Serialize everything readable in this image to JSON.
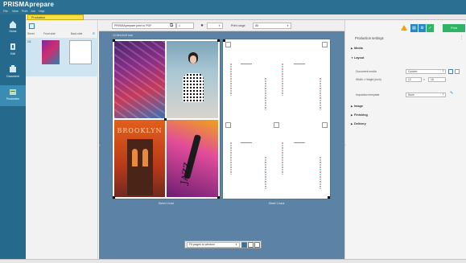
{
  "app": {
    "title": "PRISMAprepare"
  },
  "menu": [
    "File",
    "View",
    "Print",
    "Job",
    "Help"
  ],
  "ribbon": [
    {
      "key": "home",
      "label": "Home",
      "icon": "home-icon"
    },
    {
      "key": "edit",
      "label": "Edit",
      "icon": "edit-icon"
    },
    {
      "key": "document",
      "label": "Document",
      "icon": "document-icon"
    },
    {
      "key": "production",
      "label": "Production",
      "icon": "production-icon"
    }
  ],
  "doc_tab": {
    "label": "Production"
  },
  "thumbnails": {
    "headers": {
      "sheet": "Sheet",
      "front": "Front side",
      "back": "Back side"
    },
    "rows": [
      {
        "num": "1/1"
      }
    ]
  },
  "toolbar": {
    "printer": "PRISMAprepare print to PDF",
    "copies": "1",
    "print_range_label": "Print range",
    "print_range": "All"
  },
  "canvas": {
    "sheet_size": "12.00x18.00 inch",
    "front_caption": "Sheet 1 front",
    "back_caption": "Sheet 1 back",
    "brooklyn": "BROOKLYN",
    "jazz": "JAZZ"
  },
  "zoom": {
    "value": "Fit pages to window"
  },
  "panel": {
    "print_label": "Print",
    "title": "Production settings",
    "sections": {
      "media": "Media",
      "layout": "Layout",
      "image": "Image",
      "finishing": "Finishing",
      "delivery": "Delivery"
    },
    "document_media_label": "Document media",
    "document_media_value": "Custom",
    "size_label": "Width × Height (inch)",
    "width": "12",
    "height": "18",
    "times": "×",
    "imposition_label": "Imposition template",
    "imposition_value": "None"
  },
  "colors": {
    "accent": "#2b87c4",
    "print": "#2fb366",
    "warning": "#f0a500",
    "canvas": "#5c82a5",
    "tab": "#f6e04a"
  }
}
